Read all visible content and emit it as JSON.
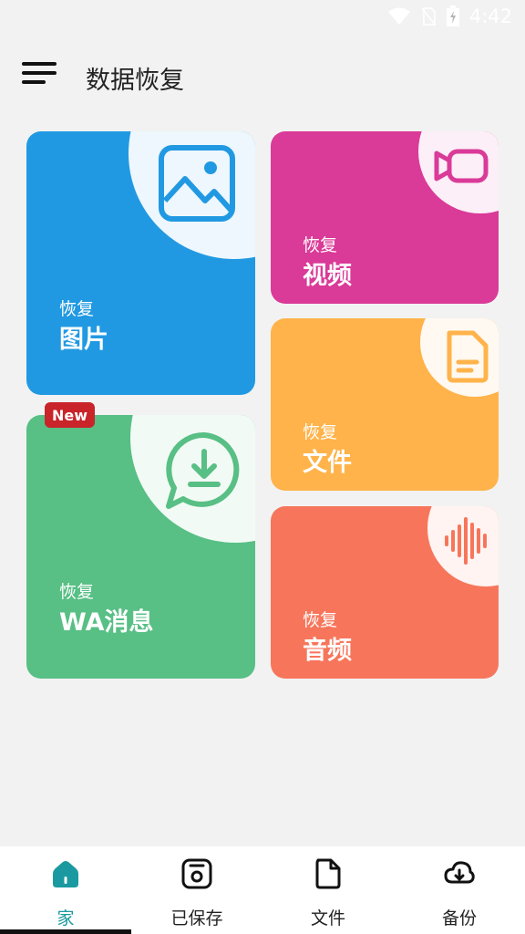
{
  "status_bar": {
    "time": "4:42",
    "icons": [
      "wifi-icon",
      "no-sim-icon",
      "battery-charging-icon"
    ]
  },
  "header": {
    "title": "数据恢复",
    "menu_icon": "hamburger-menu-icon"
  },
  "cards": {
    "photos": {
      "sub": "恢复",
      "title": "图片",
      "color": "#2199e2",
      "icon": "image-icon"
    },
    "video": {
      "sub": "恢复",
      "title": "视频",
      "color": "#da3a98",
      "icon": "video-camera-icon"
    },
    "docs": {
      "sub": "恢复",
      "title": "文件",
      "color": "#ffb34a",
      "icon": "document-icon"
    },
    "wa": {
      "sub": "恢复",
      "title": "WA消息",
      "color": "#58bf85",
      "icon": "chat-download-icon",
      "badge": "New"
    },
    "audio": {
      "sub": "恢复",
      "title": "音频",
      "color": "#f7765b",
      "icon": "sound-wave-icon"
    }
  },
  "bottom_nav": {
    "items": [
      {
        "label": "家",
        "icon": "home-icon",
        "active": true
      },
      {
        "label": "已保存",
        "icon": "saved-icon",
        "active": false
      },
      {
        "label": "文件",
        "icon": "file-icon",
        "active": false
      },
      {
        "label": "备份",
        "icon": "cloud-download-icon",
        "active": false
      }
    ]
  },
  "colors": {
    "accent": "#1a9aa0",
    "badge": "#c8242a",
    "background": "#f2f2f2"
  }
}
